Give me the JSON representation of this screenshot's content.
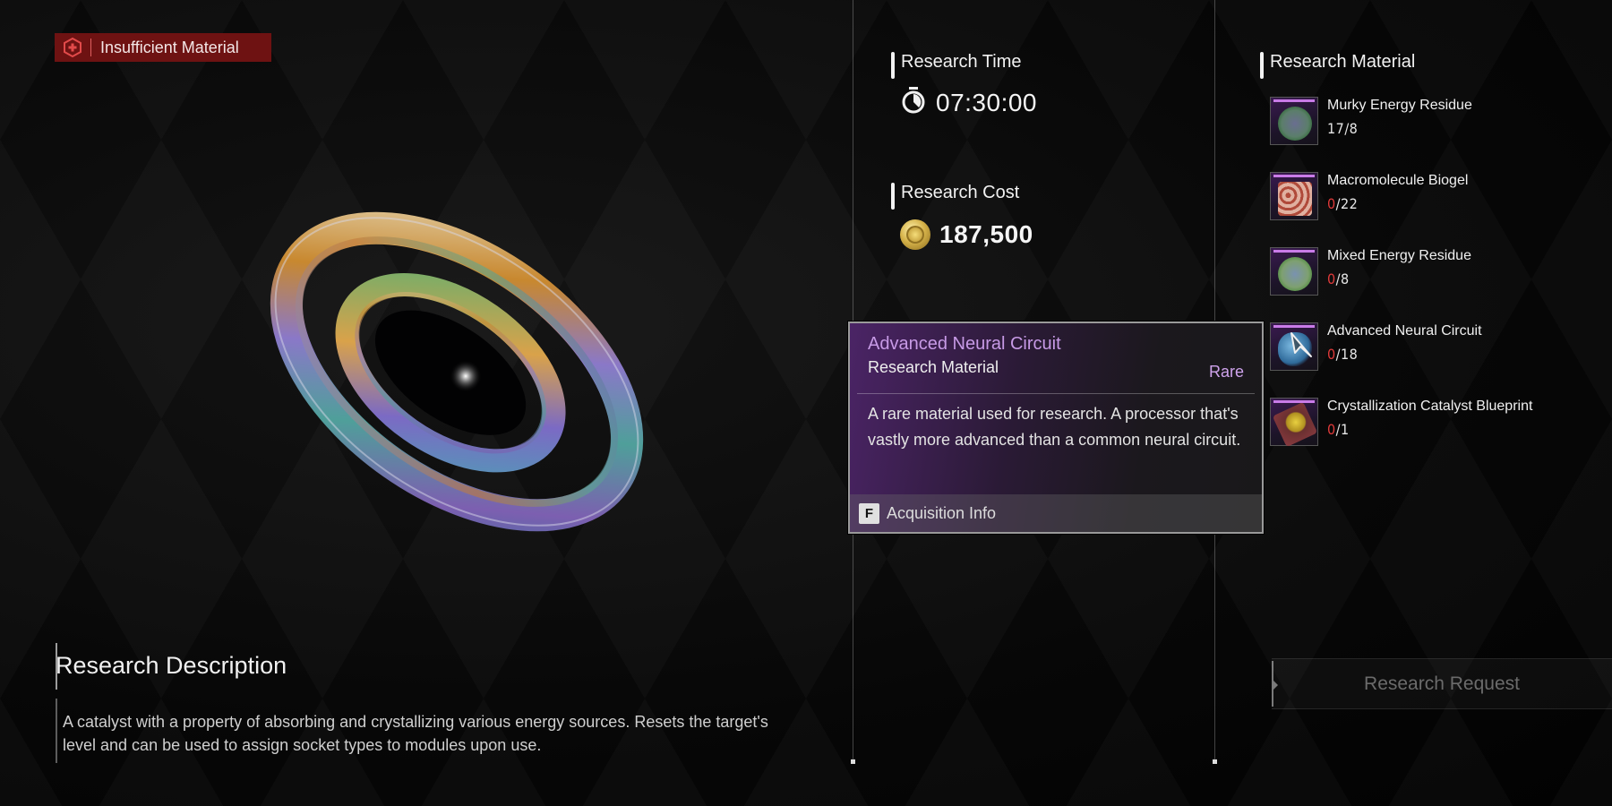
{
  "status_badge": {
    "icon": "plus-hexagon-icon",
    "label": "Insufficient Material",
    "color": "#6e1212"
  },
  "research_time": {
    "title": "Research Time",
    "icon": "stopwatch-icon",
    "value": "07:30:00"
  },
  "research_cost": {
    "title": "Research Cost",
    "icon": "gold-coin-icon",
    "value": "187,500"
  },
  "research_material": {
    "title": "Research Material",
    "items": [
      {
        "name": "Murky Energy Residue",
        "have": "17",
        "need": "8",
        "sufficient": true,
        "icon": "virus-orb-icon"
      },
      {
        "name": "Macromolecule Biogel",
        "have": "0",
        "need": "22",
        "sufficient": false,
        "icon": "biogel-block-icon"
      },
      {
        "name": "Mixed Energy Residue",
        "have": "0",
        "need": "8",
        "sufficient": false,
        "icon": "virus-orb-icon"
      },
      {
        "name": "Advanced Neural Circuit",
        "have": "0",
        "need": "18",
        "sufficient": false,
        "icon": "brain-circuit-icon"
      },
      {
        "name": "Crystallization Catalyst Blueprint",
        "have": "0",
        "need": "1",
        "sufficient": false,
        "icon": "blueprint-icon"
      }
    ]
  },
  "tooltip": {
    "title": "Advanced Neural Circuit",
    "category": "Research Material",
    "rarity": "Rare",
    "description": "A rare material used for research. A processor that's vastly more advanced than a common neural circuit.",
    "footer_key": "F",
    "footer_label": "Acquisition Info"
  },
  "description": {
    "title": "Research Description",
    "text": "A catalyst with a property of absorbing and crystallizing various energy sources. Resets the target's level and can be used to assign socket types to modules upon use."
  },
  "research_request_button": {
    "label": "Research Request",
    "enabled": false
  },
  "colors": {
    "rare_purple": "#c79ae6",
    "lack_red": "#e03a3a",
    "badge_red": "#6e1212"
  }
}
